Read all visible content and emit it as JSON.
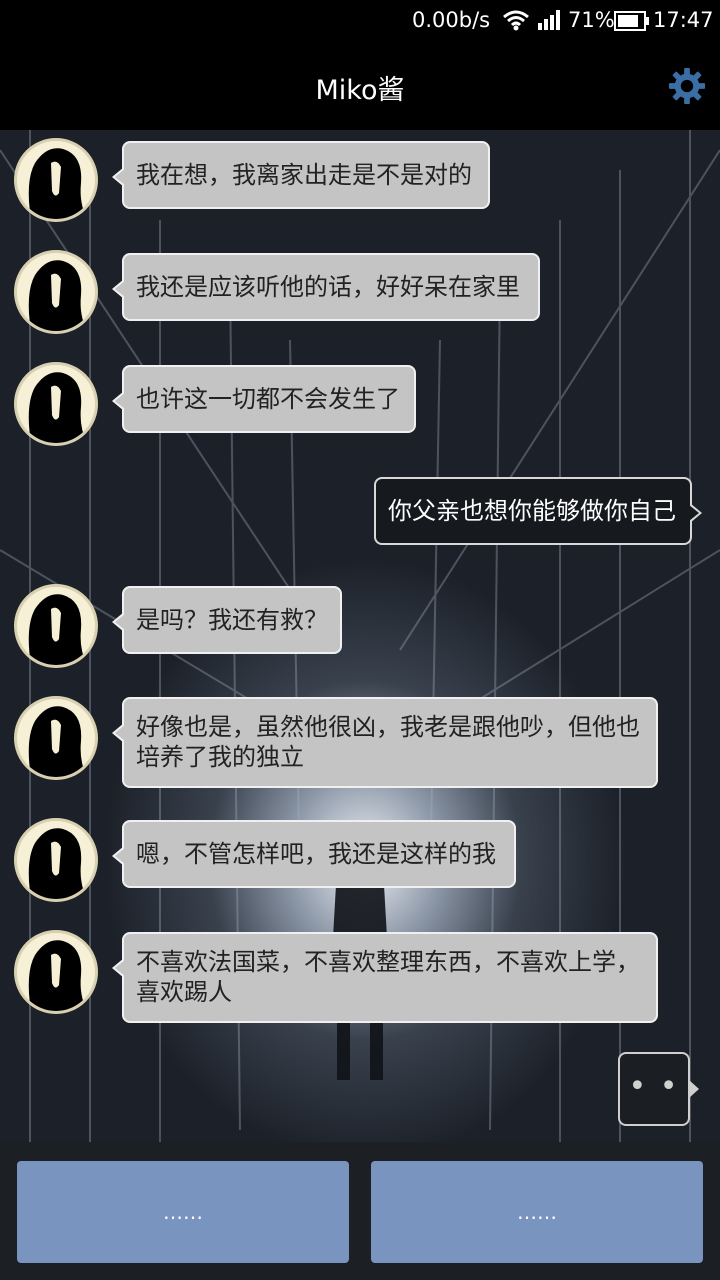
{
  "status_bar": {
    "speed": "0.00b/s",
    "battery": "71%",
    "time": "17:47"
  },
  "header": {
    "title": "Miko酱",
    "settings_icon": "gear-icon"
  },
  "messages": [
    {
      "side": "left",
      "text": "我在想，我离家出走是不是对的"
    },
    {
      "side": "left",
      "text": "我还是应该听他的话，好好呆在家里"
    },
    {
      "side": "left",
      "text": "也许这一切都不会发生了"
    },
    {
      "side": "right",
      "text": "你父亲也想你能够做你自己"
    },
    {
      "side": "left",
      "text": "是吗？我还有救？"
    },
    {
      "side": "left",
      "text": "好像也是，虽然他很凶，我老是跟他吵，但他也培养了我的独立"
    },
    {
      "side": "left",
      "text": "嗯，不管怎样吧，我还是这样的我"
    },
    {
      "side": "left",
      "text": "不喜欢法国菜，不喜欢整理东西，不喜欢上学，喜欢踢人"
    }
  ],
  "typing_indicator": "• • •",
  "choices": [
    "……",
    "……"
  ],
  "colors": {
    "bubble_left": "#c4c4c4",
    "bubble_right": "#16191d",
    "choice_button": "#7a94c0",
    "accent_gear": "#3a6ea5"
  }
}
